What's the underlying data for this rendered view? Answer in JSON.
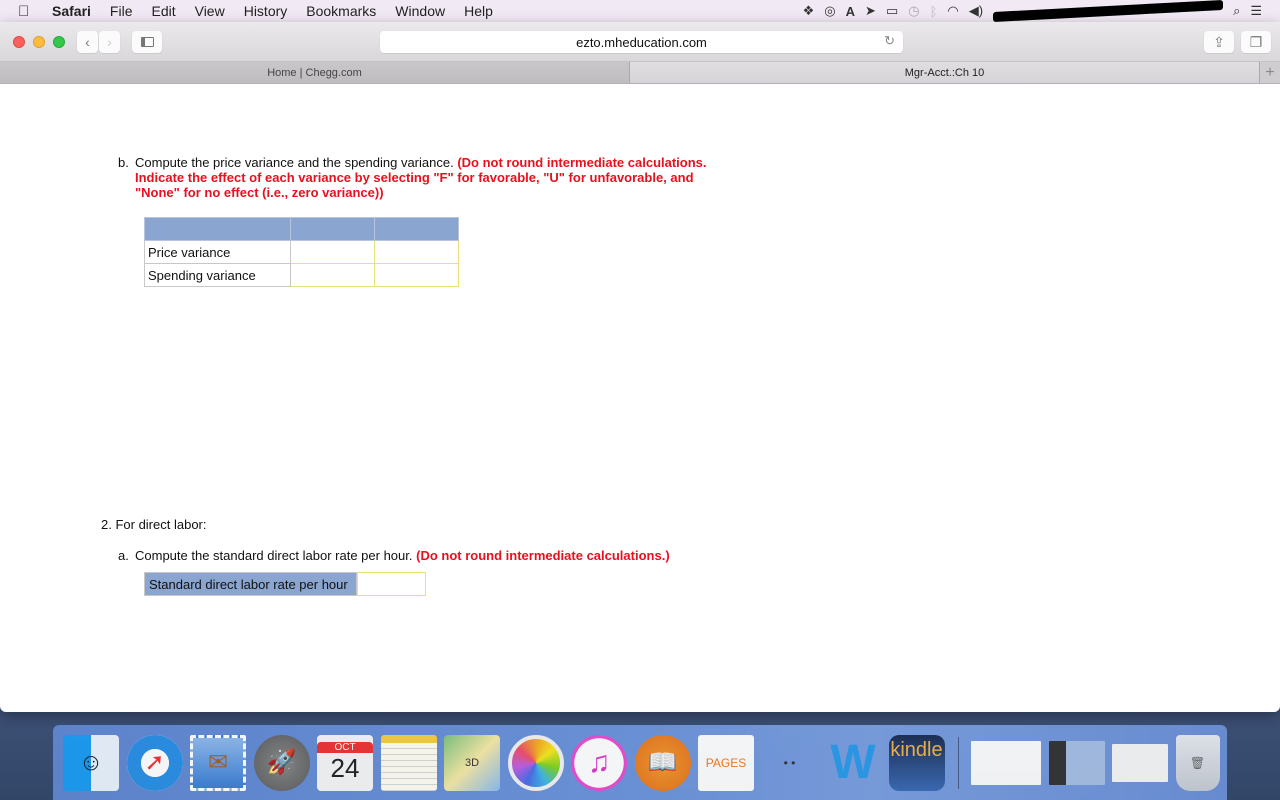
{
  "menubar": {
    "apple_icon": "apple-logo",
    "items": [
      "Safari",
      "File",
      "Edit",
      "View",
      "History",
      "Bookmarks",
      "Window",
      "Help"
    ],
    "status_icons": [
      "dropbox-icon",
      "creative-cloud-icon",
      "adobe-icon",
      "location-icon",
      "airplay-icon",
      "time-machine-icon",
      "bluetooth-icon",
      "wifi-icon",
      "volume-icon",
      "battery-icon",
      "spotlight-icon",
      "notification-center-icon"
    ]
  },
  "browser": {
    "url": "ezto.mheducation.com",
    "tabs": [
      {
        "label": "Home | Chegg.com",
        "active": false
      },
      {
        "label": "Mgr-Acct.:Ch 10",
        "active": true
      }
    ]
  },
  "content": {
    "part_b": {
      "letter": "b.",
      "instruction": "Compute the price variance and the spending variance.",
      "note": "(Do not round intermediate calculations. Indicate the effect of each variance by selecting \"F\" for favorable, \"U\" for unfavorable, and \"None\" for no effect (i.e., zero variance))",
      "table": {
        "headers": [
          "",
          "",
          ""
        ],
        "rows": [
          {
            "label": "Price variance",
            "amount": "",
            "effect": ""
          },
          {
            "label": "Spending variance",
            "amount": "",
            "effect": ""
          }
        ]
      }
    },
    "question_2": {
      "heading": "2. For direct labor:",
      "part_a": {
        "letter": "a.",
        "instruction": "Compute the standard direct labor rate per hour.",
        "note": "(Do not round intermediate calculations.)",
        "row_label": "Standard direct labor rate per hour",
        "value": ""
      }
    }
  },
  "dock": {
    "apps": [
      {
        "name": "Finder",
        "glyph": "☺"
      },
      {
        "name": "Safari",
        "glyph": "➚"
      },
      {
        "name": "Mail",
        "glyph": "✉"
      },
      {
        "name": "Launchpad",
        "glyph": "🚀"
      },
      {
        "name": "Calendar",
        "month": "OCT",
        "day": "24"
      },
      {
        "name": "Notes",
        "glyph": ""
      },
      {
        "name": "Maps",
        "glyph": "3D"
      },
      {
        "name": "Photos",
        "glyph": ""
      },
      {
        "name": "iTunes",
        "glyph": "♫"
      },
      {
        "name": "iBooks",
        "glyph": "📖"
      },
      {
        "name": "Pages",
        "glyph": "PAGES"
      },
      {
        "name": "Popcorn Time",
        "glyph": "• •"
      },
      {
        "name": "Microsoft Word",
        "glyph": "W"
      },
      {
        "name": "Kindle",
        "glyph": "kindle"
      }
    ],
    "documents": [
      "Pages document",
      "Kindle document",
      "Preview document"
    ],
    "trash": "Trash"
  }
}
